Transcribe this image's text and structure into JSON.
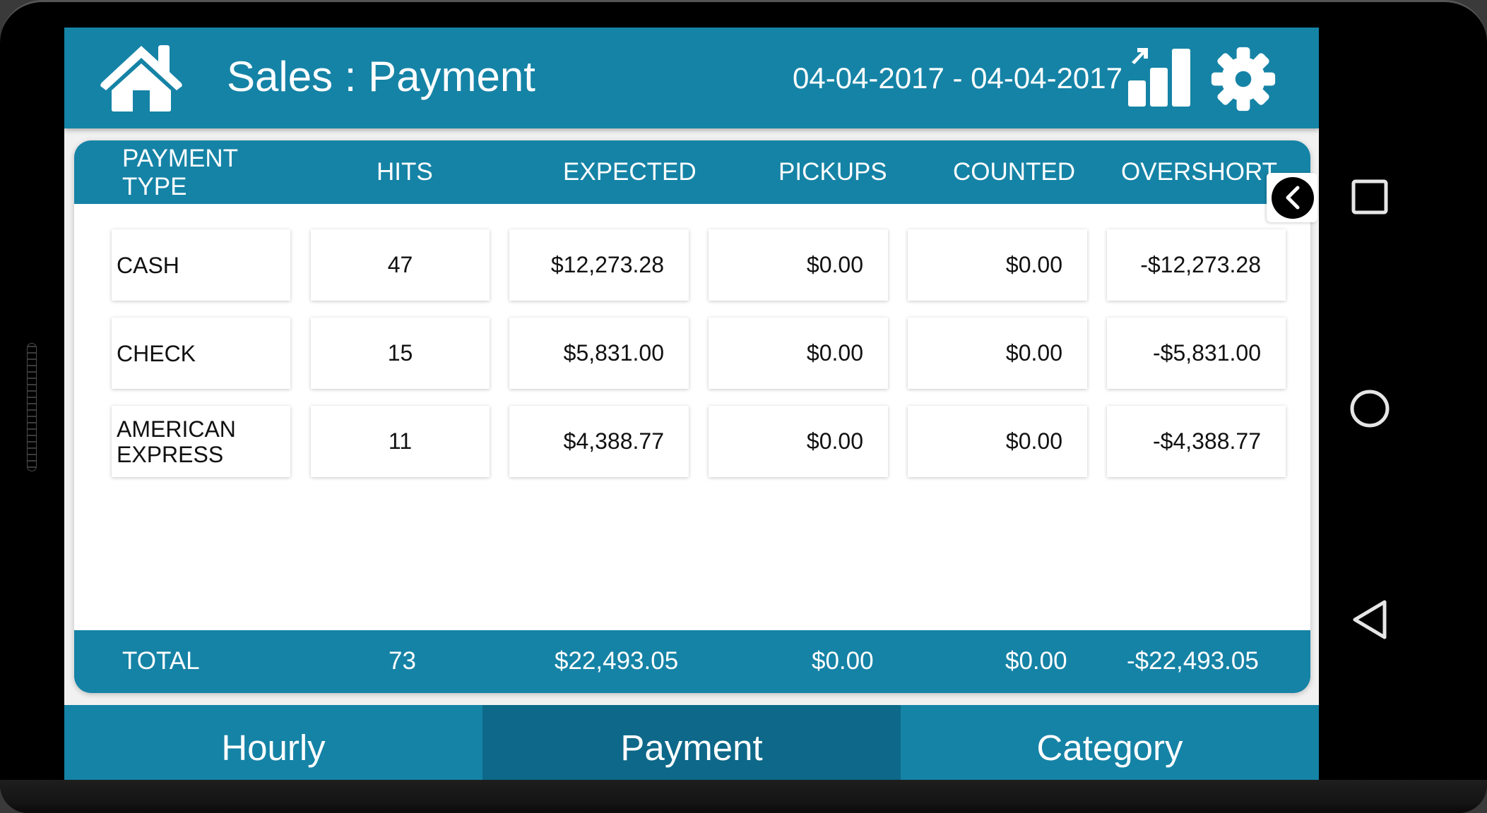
{
  "header": {
    "title": "Sales : Payment",
    "date_range": "04-04-2017 - 04-04-2017",
    "icons": {
      "home": "home-icon",
      "chart": "bar-chart-growth-icon",
      "settings": "gear-icon"
    }
  },
  "table": {
    "columns": [
      "PAYMENT TYPE",
      "HITS",
      "EXPECTED",
      "PICKUPS",
      "COUNTED",
      "OVERSHORT"
    ],
    "rows": [
      {
        "type": "CASH",
        "hits": "47",
        "expected": "$12,273.28",
        "pickups": "$0.00",
        "counted": "$0.00",
        "overshort": "-$12,273.28"
      },
      {
        "type": "CHECK",
        "hits": "15",
        "expected": "$5,831.00",
        "pickups": "$0.00",
        "counted": "$0.00",
        "overshort": "-$5,831.00"
      },
      {
        "type": "AMERICAN EXPRESS",
        "hits": "11",
        "expected": "$4,388.77",
        "pickups": "$0.00",
        "counted": "$0.00",
        "overshort": "-$4,388.77"
      }
    ],
    "total": {
      "label": "TOTAL",
      "hits": "73",
      "expected": "$22,493.05",
      "pickups": "$0.00",
      "counted": "$0.00",
      "overshort": "-$22,493.05"
    }
  },
  "collapse_button": {
    "icon": "chevron-left-icon"
  },
  "tabs": [
    {
      "label": "Hourly",
      "active": false
    },
    {
      "label": "Payment",
      "active": true
    },
    {
      "label": "Category",
      "active": false
    }
  ],
  "android_nav": {
    "recents": "square-icon",
    "home": "circle-icon",
    "back": "triangle-back-icon"
  },
  "colors": {
    "primary": "#1583a6",
    "primary_dark": "#0d6889",
    "background": "#f1f1f1",
    "card": "#ffffff"
  }
}
